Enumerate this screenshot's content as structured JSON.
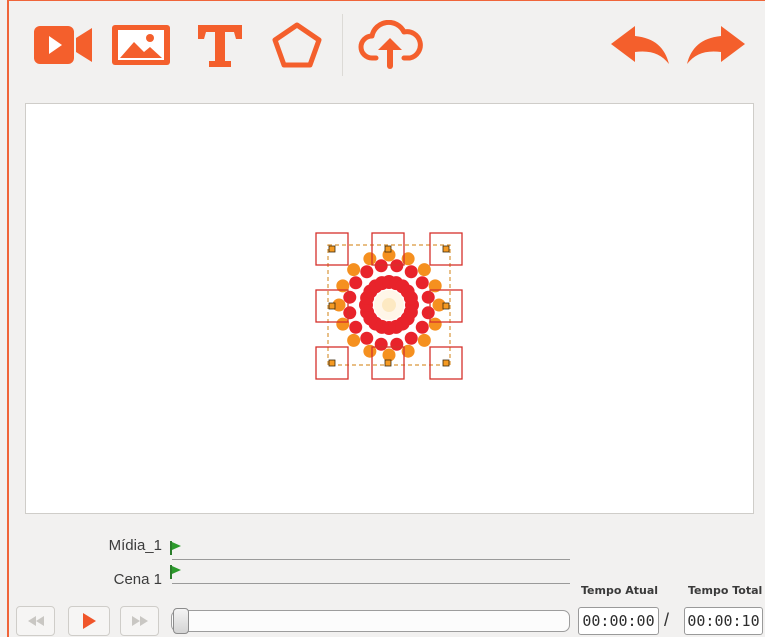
{
  "toolbar": {
    "tools": [
      {
        "name": "video-tool",
        "icon": "video-camera-icon"
      },
      {
        "name": "image-tool",
        "icon": "image-icon"
      },
      {
        "name": "text-tool",
        "icon": "text-icon"
      },
      {
        "name": "shape-tool",
        "icon": "pentagon-icon"
      },
      {
        "name": "upload-tool",
        "icon": "cloud-upload-icon"
      }
    ],
    "undo_icon": "undo-arrow-icon",
    "redo_icon": "redo-arrow-icon",
    "accent_color": "#f45f2c"
  },
  "canvas": {
    "object": "mandala-flower-image",
    "selected": true
  },
  "timeline": {
    "tracks": [
      {
        "label": "Mídia_1"
      },
      {
        "label": "Cena 1"
      }
    ]
  },
  "playback": {
    "rewind_icon": "rewind-icon",
    "play_icon": "play-icon",
    "forward_icon": "fast-forward-icon",
    "current_time_label": "Tempo Atual",
    "total_time_label": "Tempo Total",
    "current_time": "00:00:00",
    "separator": "/",
    "total_time": "00:00:10",
    "progress": 0
  }
}
